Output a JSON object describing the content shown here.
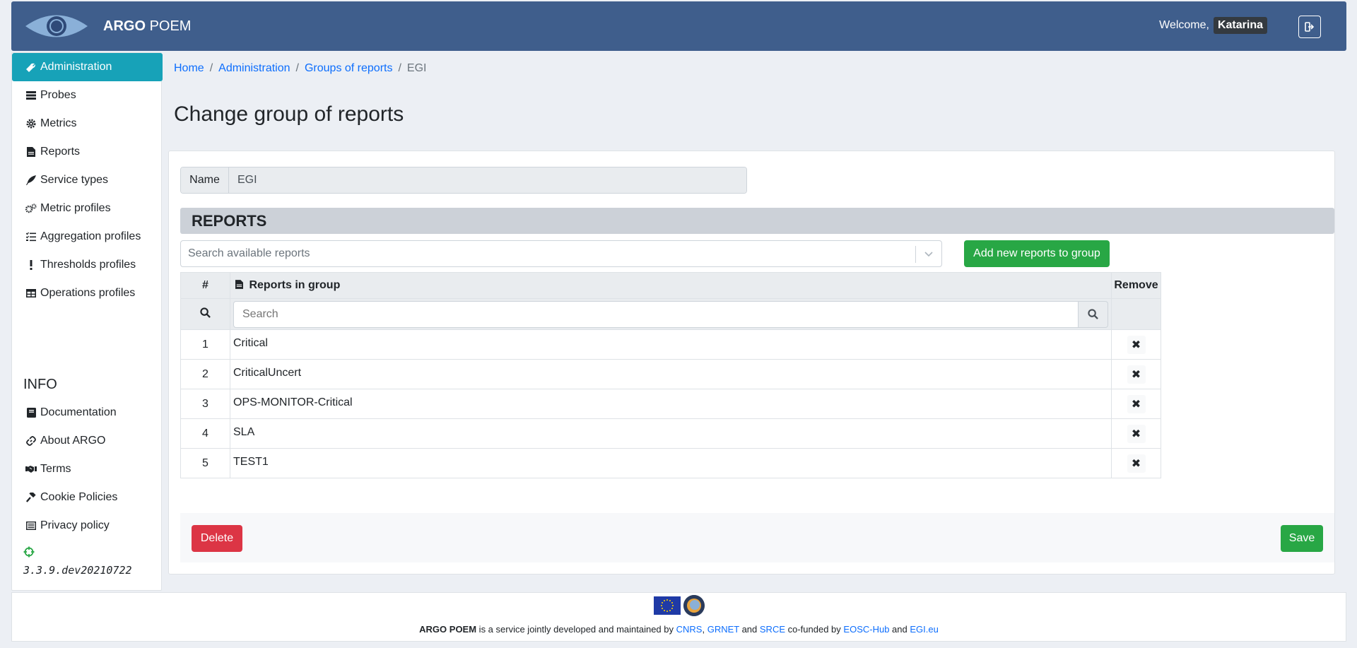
{
  "header": {
    "brand_bold": "ARGO",
    "brand_rest": "POEM",
    "welcome": "Welcome,",
    "username": "Katarina"
  },
  "sidebar": {
    "items": [
      {
        "label": "Administration",
        "icon": "wrench-icon"
      },
      {
        "label": "Probes",
        "icon": "server-icon"
      },
      {
        "label": "Metrics",
        "icon": "cog-icon"
      },
      {
        "label": "Reports",
        "icon": "file-icon"
      },
      {
        "label": "Service types",
        "icon": "feather-icon"
      },
      {
        "label": "Metric profiles",
        "icon": "cogs-icon"
      },
      {
        "label": "Aggregation profiles",
        "icon": "tasks-icon"
      },
      {
        "label": "Thresholds profiles",
        "icon": "exclamation-icon"
      },
      {
        "label": "Operations profiles",
        "icon": "table-icon"
      }
    ],
    "info_title": "INFO",
    "info_items": [
      {
        "label": "Documentation",
        "icon": "book-icon"
      },
      {
        "label": "About ARGO",
        "icon": "link-icon"
      },
      {
        "label": "Terms",
        "icon": "handshake-icon"
      },
      {
        "label": "Cookie Policies",
        "icon": "gavel-icon"
      },
      {
        "label": "Privacy policy",
        "icon": "list-alt-icon"
      }
    ],
    "version": "3.3.9.dev20210722"
  },
  "breadcrumb": {
    "items": [
      "Home",
      "Administration",
      "Groups of reports"
    ],
    "current": "EGI"
  },
  "page_title": "Change group of reports",
  "form": {
    "name_label": "Name",
    "name_value": "EGI",
    "reports_header": "REPORTS",
    "search_placeholder": "Search available reports",
    "add_button": "Add new reports to group",
    "table": {
      "col_num": "#",
      "col_name": "Reports in group",
      "col_remove": "Remove",
      "search_placeholder": "Search",
      "rows": [
        {
          "num": "1",
          "name": "Critical"
        },
        {
          "num": "2",
          "name": "CriticalUncert"
        },
        {
          "num": "3",
          "name": "OPS-MONITOR-Critical"
        },
        {
          "num": "4",
          "name": "SLA"
        },
        {
          "num": "5",
          "name": "TEST1"
        }
      ]
    },
    "delete_button": "Delete",
    "save_button": "Save"
  },
  "footer": {
    "brand": "ARGO POEM",
    "text1": " is a service jointly developed and maintained by ",
    "cnrs": "CNRS",
    "comma": ", ",
    "grnet": "GRNET",
    "and1": " and ",
    "srce": "SRCE",
    "text2": " co-funded by ",
    "eosc": "EOSC-Hub",
    "and2": " and ",
    "egi": "EGI.eu"
  },
  "colors": {
    "header": "#3f5e8c",
    "active": "#17a2b8",
    "success": "#28a745",
    "danger": "#dc3545"
  }
}
